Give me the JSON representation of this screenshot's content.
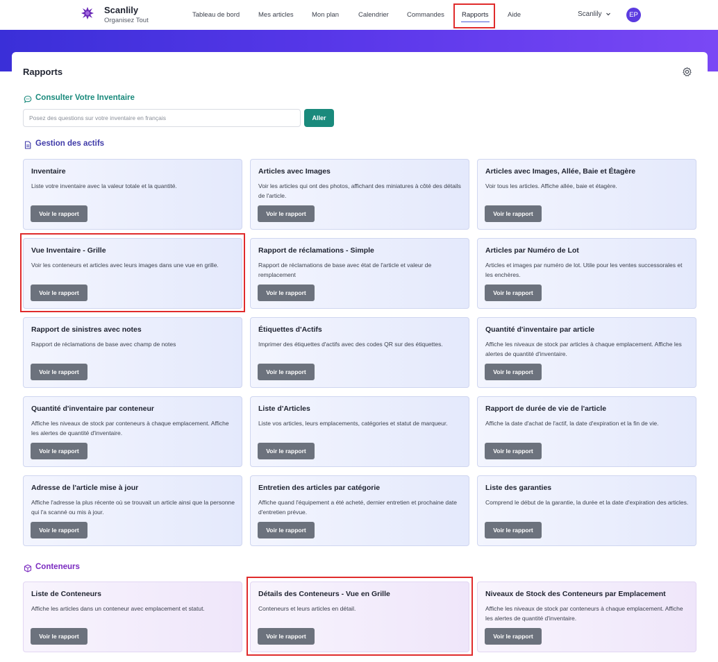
{
  "brand": {
    "name": "Scanlily",
    "tagline": "Organisez Tout"
  },
  "nav": {
    "items": [
      {
        "label": "Tableau de bord"
      },
      {
        "label": "Mes articles"
      },
      {
        "label": "Mon plan"
      },
      {
        "label": "Calendrier"
      },
      {
        "label": "Commandes"
      },
      {
        "label": "Rapports"
      },
      {
        "label": "Aide"
      }
    ],
    "active": "Rapports",
    "user_label": "Scanlily",
    "avatar_initials": "EP"
  },
  "colors": {
    "banner": "#5b2ee6",
    "accent_teal": "#1a8a7c",
    "section_indigo": "#3f3aa8",
    "section_purple": "#7b2bc0",
    "highlight": "#e02b2b",
    "button_gray": "#6c727d"
  },
  "page": {
    "title": "Rapports"
  },
  "query": {
    "title": "Consulter Votre Inventaire",
    "icon": "chat-bubble-icon",
    "placeholder": "Posez des questions sur votre inventaire en français",
    "value": "",
    "button": "Aller"
  },
  "sections": [
    {
      "title": "Gestion des actifs",
      "icon": "document-icon",
      "reports": [
        {
          "title": "Inventaire",
          "desc": "Liste votre inventaire avec la valeur totale et la quantité.",
          "button": "Voir le rapport"
        },
        {
          "title": "Articles avec Images",
          "desc": "Voir les articles qui ont des photos, affichant des miniatures à côté des détails de l'article.",
          "button": "Voir le rapport"
        },
        {
          "title": "Articles avec Images, Allée, Baie et Étagère",
          "desc": "Voir tous les articles. Affiche allée, baie et étagère.",
          "button": "Voir le rapport"
        },
        {
          "title": "Vue Inventaire - Grille",
          "desc": "Voir les conteneurs et articles avec leurs images dans une vue en grille.",
          "button": "Voir le rapport"
        },
        {
          "title": "Rapport de réclamations - Simple",
          "desc": "Rapport de réclamations de base avec état de l'article et valeur de remplacement",
          "button": "Voir le rapport"
        },
        {
          "title": "Articles par Numéro de Lot",
          "desc": "Articles et images par numéro de lot. Utile pour les ventes successorales et les enchères.",
          "button": "Voir le rapport"
        },
        {
          "title": "Rapport de sinistres avec notes",
          "desc": "Rapport de réclamations de base avec champ de notes",
          "button": "Voir le rapport"
        },
        {
          "title": "Étiquettes d'Actifs",
          "desc": "Imprimer des étiquettes d'actifs avec des codes QR sur des étiquettes.",
          "button": "Voir le rapport"
        },
        {
          "title": "Quantité d'inventaire par article",
          "desc": "Affiche les niveaux de stock par articles à chaque emplacement. Affiche les alertes de quantité d'inventaire.",
          "button": "Voir le rapport"
        },
        {
          "title": "Quantité d'inventaire par conteneur",
          "desc": "Affiche les niveaux de stock par conteneurs à chaque emplacement. Affiche les alertes de quantité d'inventaire.",
          "button": "Voir le rapport"
        },
        {
          "title": "Liste d'Articles",
          "desc": "Liste vos articles, leurs emplacements, catégories et statut de marqueur.",
          "button": "Voir le rapport"
        },
        {
          "title": "Rapport de durée de vie de l'article",
          "desc": "Affiche la date d'achat de l'actif, la date d'expiration et la fin de vie.",
          "button": "Voir le rapport"
        },
        {
          "title": "Adresse de l'article mise à jour",
          "desc": "Affiche l'adresse la plus récente où se trouvait un article ainsi que la personne qui l'a scanné ou mis à jour.",
          "button": "Voir le rapport"
        },
        {
          "title": "Entretien des articles par catégorie",
          "desc": "Affiche quand l'équipement a été acheté, dernier entretien et prochaine date d'entretien prévue.",
          "button": "Voir le rapport"
        },
        {
          "title": "Liste des garanties",
          "desc": "Comprend le début de la garantie, la durée et la date d'expiration des articles.",
          "button": "Voir le rapport"
        }
      ]
    },
    {
      "title": "Conteneurs",
      "icon": "box-icon",
      "reports": [
        {
          "title": "Liste de Conteneurs",
          "desc": "Affiche les articles dans un conteneur avec emplacement et statut.",
          "button": "Voir le rapport"
        },
        {
          "title": "Détails des Conteneurs - Vue en Grille",
          "desc": "Conteneurs et leurs articles en détail.",
          "button": "Voir le rapport"
        },
        {
          "title": "Niveaux de Stock des Conteneurs par Emplacement",
          "desc": "Affiche les niveaux de stock par conteneurs à chaque emplacement. Affiche les alertes de quantité d'inventaire.",
          "button": "Voir le rapport"
        }
      ]
    }
  ]
}
